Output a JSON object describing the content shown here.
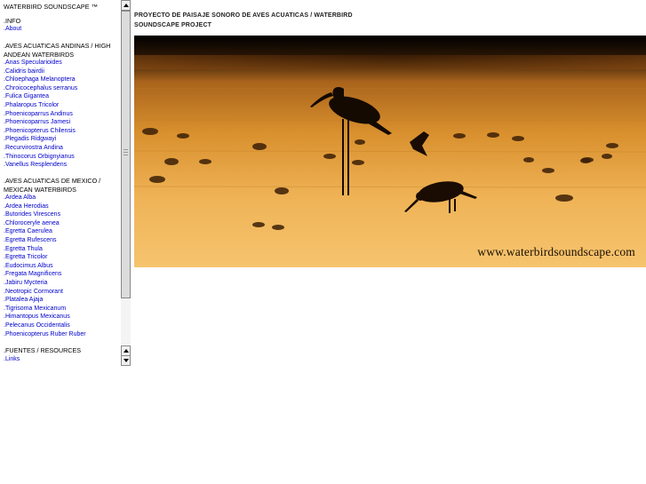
{
  "sidebar": {
    "site_title": "WATERBIRD SOUNDSCAPE ™",
    "info": {
      "heading": ".INFO",
      "links": [
        ".About"
      ]
    },
    "andinas": {
      "heading": ".AVES ACUATICAS ANDINAS / HIGH ANDEAN WATERBIRDS",
      "links": [
        ".Anas Specularioides",
        ".Calidris bairdii",
        ".Chloephaga Melanoptera",
        ".Chroicocephalus serranus",
        ".Fulica Gigantea",
        ".Phalaropus Tricolor",
        ".Phoenicoparrus Andinus",
        ".Phoenicoparrus Jamesi",
        ".Phoenicopterus Chilensis",
        ".Plegadis Ridgwayi",
        ".Recurvirostra Andina",
        ".Thinocorus Orbignyianus",
        ".Vanellus Resplendens"
      ]
    },
    "mexico": {
      "heading": ".AVES ACUATICAS DE MEXICO / MEXICAN WATERBIRDS",
      "links": [
        ".Ardea Alba",
        ".Ardea Herodias",
        ".Butorides Virescens",
        ".Chloroceryle aenea",
        ".Egretta Caerulea",
        ".Egretta Rufescens",
        ".Egretta Thula",
        ".Egretta Tricolor",
        ".Eudocimus Albus",
        ".Fregata Magnificens",
        ".Jabiru Mycteria",
        ".Neotropic Cormorant",
        ".Platalea Ajaja",
        ".Tigrisoma Mexicanum",
        ".Himantopus Mexicanus",
        ".Pelecanus Occidentalis",
        ".Phoenicopterus Ruber Ruber"
      ]
    },
    "fuentes": {
      "heading": ".FUENTES / RESOURCES",
      "links": [
        ".Links"
      ]
    }
  },
  "main": {
    "project_title": "PROYECTO DE PAISAJE SONORO DE AVES ACUATICAS / WATERBIRD SOUNDSCAPE PROJECT",
    "hero_watermark": "www.waterbirdsoundscape.com"
  },
  "colors": {
    "link": "#0000cc",
    "hero_sky": "#d98a2a",
    "hero_water": "#f2b85a"
  },
  "icons": [
    "scroll-up-arrow-icon",
    "scroll-down-arrow-icon"
  ]
}
